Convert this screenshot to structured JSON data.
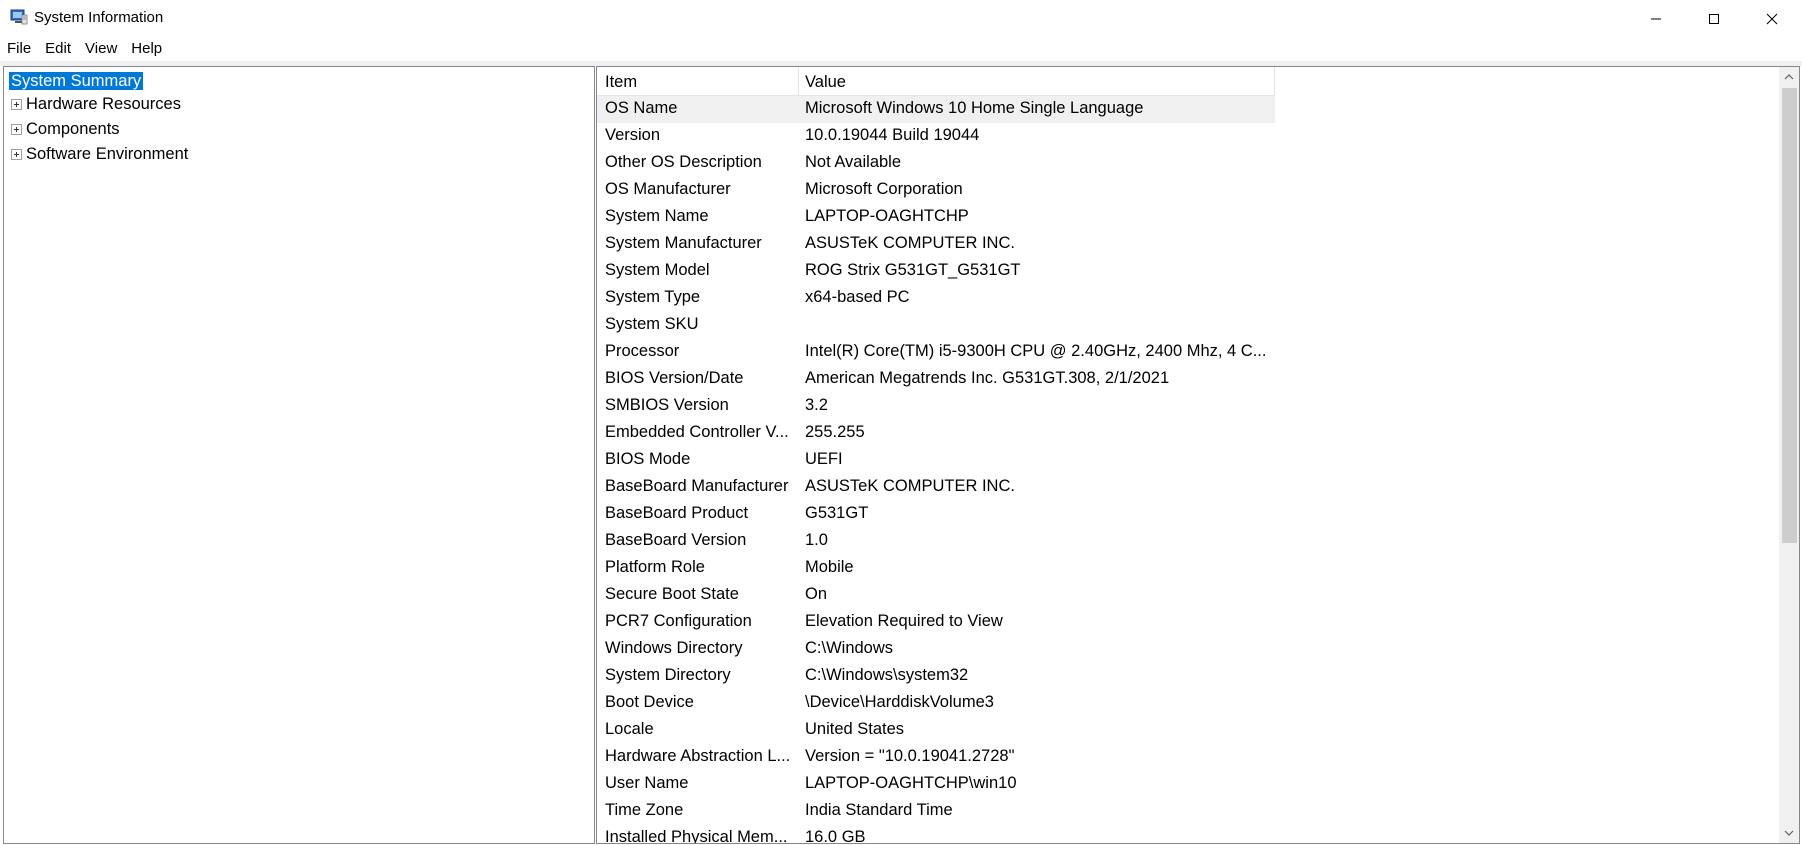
{
  "window": {
    "title": "System Information",
    "icon": "system-information-icon"
  },
  "menu": [
    "File",
    "Edit",
    "View",
    "Help"
  ],
  "tree": {
    "selected": "System Summary",
    "items": [
      "Hardware Resources",
      "Components",
      "Software Environment"
    ]
  },
  "table": {
    "headers": {
      "item": "Item",
      "value": "Value"
    },
    "rows": [
      {
        "item": "OS Name",
        "value": "Microsoft Windows 10 Home Single Language"
      },
      {
        "item": "Version",
        "value": "10.0.19044 Build 19044"
      },
      {
        "item": "Other OS Description",
        "value": "Not Available"
      },
      {
        "item": "OS Manufacturer",
        "value": "Microsoft Corporation"
      },
      {
        "item": "System Name",
        "value": "LAPTOP-OAGHTCHP"
      },
      {
        "item": "System Manufacturer",
        "value": "ASUSTeK COMPUTER INC."
      },
      {
        "item": "System Model",
        "value": "ROG Strix G531GT_G531GT"
      },
      {
        "item": "System Type",
        "value": "x64-based PC"
      },
      {
        "item": "System SKU",
        "value": ""
      },
      {
        "item": "Processor",
        "value": "Intel(R) Core(TM) i5-9300H CPU @ 2.40GHz, 2400 Mhz, 4 C..."
      },
      {
        "item": "BIOS Version/Date",
        "value": "American Megatrends Inc. G531GT.308, 2/1/2021"
      },
      {
        "item": "SMBIOS Version",
        "value": "3.2"
      },
      {
        "item": "Embedded Controller V...",
        "value": "255.255"
      },
      {
        "item": "BIOS Mode",
        "value": "UEFI"
      },
      {
        "item": "BaseBoard Manufacturer",
        "value": "ASUSTeK COMPUTER INC."
      },
      {
        "item": "BaseBoard Product",
        "value": "G531GT"
      },
      {
        "item": "BaseBoard Version",
        "value": "1.0"
      },
      {
        "item": "Platform Role",
        "value": "Mobile"
      },
      {
        "item": "Secure Boot State",
        "value": "On"
      },
      {
        "item": "PCR7 Configuration",
        "value": "Elevation Required to View"
      },
      {
        "item": "Windows Directory",
        "value": "C:\\Windows"
      },
      {
        "item": "System Directory",
        "value": "C:\\Windows\\system32"
      },
      {
        "item": "Boot Device",
        "value": "\\Device\\HarddiskVolume3"
      },
      {
        "item": "Locale",
        "value": "United States"
      },
      {
        "item": "Hardware Abstraction L...",
        "value": "Version = \"10.0.19041.2728\""
      },
      {
        "item": "User Name",
        "value": "LAPTOP-OAGHTCHP\\win10"
      },
      {
        "item": "Time Zone",
        "value": "India Standard Time"
      },
      {
        "item": "Installed Physical Mem...",
        "value": "16.0 GB"
      }
    ]
  },
  "colors": {
    "selection": "#0078d7",
    "first_row_highlight": "#f0f0f0",
    "border": "#828790",
    "scroll_thumb": "#cdcdcd"
  },
  "scrollbar": {
    "position_fraction": 0.0,
    "visible_fraction": 0.62
  }
}
